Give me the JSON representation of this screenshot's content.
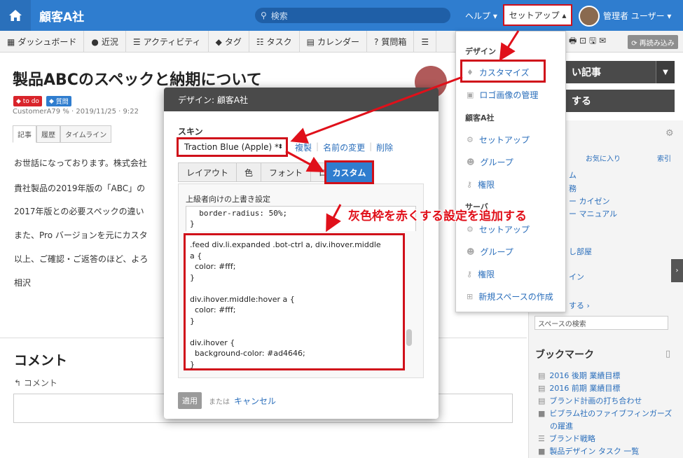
{
  "header": {
    "home_icon": "home-icon",
    "app_title": "顧客A社",
    "search_placeholder": "検索",
    "help": "ヘルプ ▾",
    "setup": "セットアップ ▴",
    "user": "管理者 ユーザー ▾"
  },
  "nav": {
    "items": [
      {
        "label": "ダッシュボード",
        "icon": "▦"
      },
      {
        "label": "近況",
        "icon": "●"
      },
      {
        "label": "アクティビティ",
        "icon": "☰"
      },
      {
        "label": "タグ",
        "icon": "◆"
      },
      {
        "label": "タスク",
        "icon": "☷"
      },
      {
        "label": "カレンダー",
        "icon": "▤"
      },
      {
        "label": "質問箱",
        "icon": "?"
      },
      {
        "label": "",
        "icon": "☰"
      }
    ],
    "tools": "🖶 ⊡ 🖫 ✉",
    "reload": "⟳ 再読み込み"
  },
  "doc": {
    "title": "製品ABCのスペックと納期について",
    "badge_todo": "to do",
    "badge_question": "質問",
    "meta": "CustomerA79 % · 2019/11/25 · 9:22",
    "tabs": [
      "記事",
      "履歴",
      "タイムライン"
    ],
    "lines": [
      "お世話になっております。株式会社",
      "貴社製品の2019年版の「ABC」の",
      "2017年版との必要スペックの違い",
      "また、Pro バージョンを元にカスタ",
      "以上、ご確認・ご返答のほど、よろ",
      "相沢"
    ],
    "comment_heading": "コメント",
    "comment_link": "↰ コメント"
  },
  "right": {
    "btn1": "い記事",
    "btn2": "する",
    "tab_fav": "お気に入り",
    "tab_index": "索引",
    "links": [
      "ム",
      "務",
      "ー カイゼン",
      "ー マニュアル",
      "し部屋",
      "イン",
      "する ›"
    ],
    "space_search": "スペースの検索",
    "bookmark_title": "ブックマーク",
    "bookmarks": [
      {
        "icon": "▤",
        "label": "2016 後期 業績目標"
      },
      {
        "icon": "▤",
        "label": "2016 前期 業績目標"
      },
      {
        "icon": "▤",
        "label": "ブランド計画の打ち合わせ"
      },
      {
        "icon": "■",
        "label": "ビブラム社のファイブフィンガーズ"
      },
      {
        "icon": "",
        "label": "の躍進"
      },
      {
        "icon": "☰",
        "label": "ブランド戦略"
      },
      {
        "icon": "■",
        "label": "製品デザイン タスク 一覧"
      }
    ]
  },
  "dropdown": {
    "design_head": "デザイン",
    "customize": "カスタマイズ",
    "logo": "ロゴ画像の管理",
    "company_head": "顧客A社",
    "setup1": "セットアップ",
    "group1": "グループ",
    "perm1": "権限",
    "server_head": "サーバ",
    "setup2": "セットアップ",
    "group2": "グループ",
    "perm2": "権限",
    "new_space": "新規スペースの作成"
  },
  "dialog": {
    "title": "デザイン: 顧客A社",
    "skin_label": "スキン",
    "skin_value": "Traction Blue (Apple) *",
    "dup": "複製",
    "rename": "名前の変更",
    "delete": "削除",
    "tabs": [
      "レイアウト",
      "色",
      "フォント",
      "ロゴ"
    ],
    "custom_tab": "カスタム",
    "adv_label": "上級者向けの上書き設定",
    "code_top": "  border-radius: 50%;\n}",
    "code_main": ".feed div.li.expanded .bot-ctrl a, div.ihover.middle\na {\n  color: #fff;\n}\n\ndiv.ihover.middle:hover a {\n  color: #fff;\n}\n\ndiv.ihover {\n  background-color: #ad4646;\n}",
    "apply": "適用",
    "or": "または",
    "cancel": "キャンセル"
  },
  "annotation": "灰色枠を赤くする設定を追加する",
  "colors": {
    "accent": "#2f7dcf",
    "highlight": "#d0101a"
  }
}
